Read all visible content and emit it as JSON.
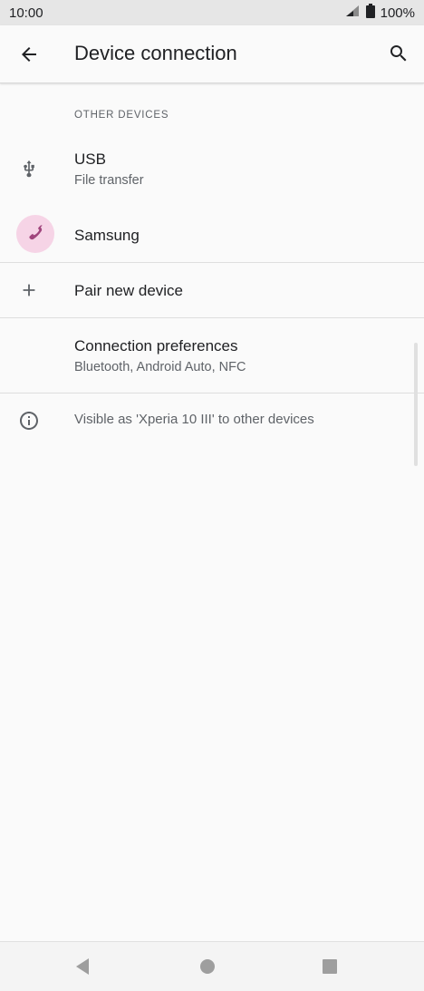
{
  "status_bar": {
    "time": "10:00",
    "battery": "100%",
    "icons": [
      "signal-icon",
      "battery-icon"
    ]
  },
  "app_bar": {
    "title": "Device connection",
    "back_icon": "arrow-back-icon",
    "search_icon": "search-icon"
  },
  "section": {
    "header": "OTHER DEVICES"
  },
  "rows": {
    "usb": {
      "title": "USB",
      "subtitle": "File transfer",
      "icon": "usb-icon"
    },
    "samsung": {
      "title": "Samsung",
      "icon": "phone-icon",
      "icon_color": "#a0457c",
      "icon_bg": "#f6d4e6"
    },
    "pair": {
      "title": "Pair new device",
      "icon": "plus-icon"
    },
    "prefs": {
      "title": "Connection preferences",
      "subtitle": "Bluetooth, Android Auto, NFC"
    },
    "visible": {
      "text": "Visible as 'Xperia 10 III' to other devices",
      "icon": "info-icon"
    }
  },
  "nav_bar": {
    "back": "nav-back-icon",
    "home": "nav-home-icon",
    "recents": "nav-recents-icon"
  }
}
